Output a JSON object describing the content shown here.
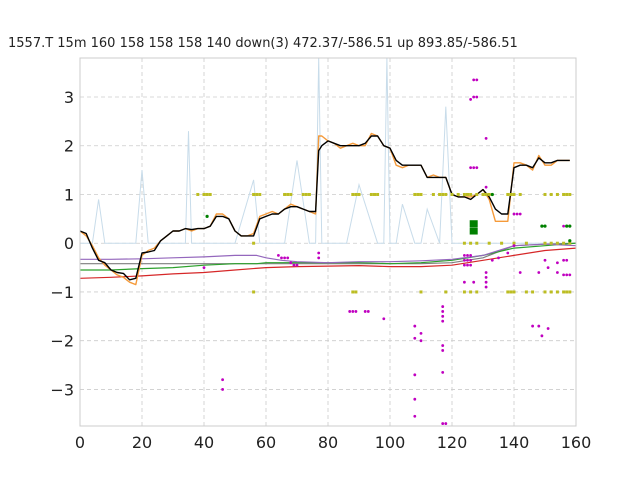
{
  "chart_data": {
    "type": "line",
    "title": "1557.T 15m 160 158 158 158 140  down(3) 472.37/-586.51 up 893.85/-586.51",
    "xlabel": "",
    "ylabel": "",
    "xlim": [
      0,
      160
    ],
    "ylim": [
      -3.75,
      3.8
    ],
    "xticks": [
      0,
      20,
      40,
      60,
      80,
      100,
      120,
      140,
      160
    ],
    "yticks": [
      -3,
      -2,
      -1,
      0,
      1,
      2,
      3
    ],
    "xtick_labels": [
      "0",
      "20",
      "40",
      "60",
      "80",
      "100",
      "120",
      "140",
      "160"
    ],
    "ytick_labels": [
      "−3",
      "−2",
      "−1",
      "0",
      "1",
      "2",
      "3"
    ],
    "grid": true,
    "colors": {
      "price": "#000000",
      "orange": "#f59a3a",
      "purple": "#9467bd",
      "green": "#2ca02c",
      "red": "#d62728",
      "gray": "#7f7f7f",
      "background_spikes": "#c8dcea",
      "olive_marks": "#bcbd22",
      "magenta_marks": "#c000c0",
      "green_marks": "#008000"
    },
    "series": [
      {
        "key": "price",
        "x": [
          0,
          2,
          4,
          6,
          8,
          10,
          12,
          14,
          16,
          18,
          20,
          22,
          24,
          26,
          28,
          30,
          32,
          34,
          36,
          38,
          40,
          42,
          44,
          46,
          48,
          50,
          52,
          54,
          56,
          58,
          60,
          62,
          64,
          66,
          68,
          70,
          72,
          74,
          76,
          77,
          78,
          80,
          82,
          84,
          86,
          88,
          90,
          92,
          94,
          96,
          98,
          100,
          102,
          104,
          106,
          108,
          110,
          112,
          114,
          116,
          118,
          120,
          122,
          124,
          126,
          128,
          130,
          132,
          134,
          136,
          138,
          140,
          142,
          144,
          146,
          148,
          150,
          152,
          154,
          156,
          158
        ],
        "y": [
          0.25,
          0.2,
          -0.1,
          -0.35,
          -0.4,
          -0.55,
          -0.6,
          -0.62,
          -0.75,
          -0.72,
          -0.2,
          -0.18,
          -0.15,
          0.05,
          0.15,
          0.25,
          0.25,
          0.3,
          0.28,
          0.3,
          0.3,
          0.35,
          0.55,
          0.55,
          0.5,
          0.25,
          0.15,
          0.15,
          0.15,
          0.5,
          0.55,
          0.6,
          0.6,
          0.7,
          0.75,
          0.75,
          0.7,
          0.65,
          0.65,
          1.9,
          2.0,
          2.1,
          2.05,
          2.0,
          2.0,
          2.0,
          2.0,
          2.05,
          2.2,
          2.2,
          2.0,
          1.95,
          1.7,
          1.6,
          1.6,
          1.6,
          1.6,
          1.35,
          1.35,
          1.35,
          1.35,
          1.0,
          0.95,
          0.95,
          0.9,
          1.0,
          1.1,
          0.95,
          0.7,
          0.6,
          0.6,
          1.55,
          1.6,
          1.6,
          1.55,
          1.75,
          1.65,
          1.65,
          1.7,
          1.7,
          1.7
        ]
      },
      {
        "key": "orange",
        "x": [
          0,
          2,
          4,
          6,
          8,
          10,
          12,
          14,
          16,
          18,
          20,
          22,
          24,
          26,
          28,
          30,
          32,
          34,
          36,
          38,
          40,
          42,
          44,
          46,
          48,
          50,
          52,
          54,
          56,
          58,
          60,
          62,
          64,
          66,
          68,
          70,
          72,
          74,
          76,
          77,
          78,
          80,
          82,
          84,
          86,
          88,
          90,
          92,
          94,
          96,
          98,
          100,
          102,
          104,
          106,
          108,
          110,
          112,
          114,
          116,
          118,
          120,
          122,
          124,
          126,
          128,
          130,
          132,
          134,
          136,
          138,
          140,
          142,
          144,
          146,
          148,
          150,
          152,
          154,
          156,
          158
        ],
        "y": [
          0.25,
          0.15,
          -0.05,
          -0.3,
          -0.45,
          -0.55,
          -0.65,
          -0.7,
          -0.8,
          -0.85,
          -0.25,
          -0.15,
          -0.1,
          0.05,
          0.15,
          0.25,
          0.25,
          0.3,
          0.25,
          0.3,
          0.3,
          0.35,
          0.6,
          0.6,
          0.5,
          0.25,
          0.15,
          0.15,
          0.2,
          0.55,
          0.6,
          0.65,
          0.6,
          0.7,
          0.8,
          0.75,
          0.7,
          0.65,
          0.6,
          2.2,
          2.2,
          2.1,
          2.05,
          1.95,
          2.0,
          2.05,
          2.0,
          2.0,
          2.25,
          2.2,
          2.0,
          1.95,
          1.6,
          1.55,
          1.6,
          1.6,
          1.6,
          1.35,
          1.4,
          1.35,
          1.35,
          1.0,
          0.95,
          0.95,
          0.95,
          1.0,
          1.1,
          0.9,
          0.45,
          0.45,
          0.45,
          1.65,
          1.65,
          1.6,
          1.5,
          1.8,
          1.6,
          1.6,
          1.7,
          1.7,
          1.7
        ]
      },
      {
        "key": "purple",
        "x": [
          0,
          10,
          20,
          30,
          40,
          50,
          57,
          60,
          65,
          70,
          80,
          90,
          100,
          110,
          120,
          130,
          140,
          150,
          160
        ],
        "y": [
          -0.33,
          -0.33,
          -0.32,
          -0.3,
          -0.28,
          -0.25,
          -0.25,
          -0.3,
          -0.35,
          -0.38,
          -0.4,
          -0.38,
          -0.38,
          -0.36,
          -0.33,
          -0.25,
          -0.05,
          -0.02,
          -0.05
        ]
      },
      {
        "key": "green",
        "x": [
          0,
          10,
          20,
          30,
          40,
          50,
          57,
          60,
          65,
          70,
          80,
          90,
          100,
          110,
          120,
          130,
          140,
          150,
          160
        ],
        "y": [
          -0.55,
          -0.55,
          -0.52,
          -0.5,
          -0.45,
          -0.42,
          -0.42,
          -0.4,
          -0.4,
          -0.4,
          -0.4,
          -0.4,
          -0.42,
          -0.4,
          -0.35,
          -0.25,
          -0.1,
          -0.05,
          0.0
        ]
      },
      {
        "key": "red",
        "x": [
          0,
          10,
          20,
          30,
          40,
          50,
          60,
          70,
          80,
          90,
          100,
          110,
          120,
          130,
          140,
          150,
          160
        ],
        "y": [
          -0.72,
          -0.7,
          -0.67,
          -0.63,
          -0.6,
          -0.55,
          -0.5,
          -0.48,
          -0.47,
          -0.46,
          -0.48,
          -0.48,
          -0.45,
          -0.35,
          -0.25,
          -0.15,
          -0.1
        ]
      },
      {
        "key": "gray",
        "x": [
          0,
          60,
          70,
          80,
          90,
          100,
          110,
          120,
          130,
          140,
          150,
          160
        ],
        "y": [
          -0.42,
          -0.42,
          -0.42,
          -0.42,
          -0.42,
          -0.42,
          -0.42,
          -0.4,
          -0.3,
          -0.05,
          -0.02,
          0.0
        ]
      },
      {
        "key": "background_spikes",
        "x": [
          0,
          4,
          6,
          8,
          16,
          18,
          20,
          22,
          30,
          34,
          35,
          36,
          40,
          50,
          56,
          58,
          60,
          66,
          70,
          74,
          76,
          77,
          78,
          80,
          86,
          90,
          96,
          98,
          99,
          100,
          102,
          104,
          108,
          110,
          112,
          116,
          118,
          120,
          126,
          128,
          130,
          136,
          138,
          140,
          146,
          150,
          156,
          160
        ],
        "y": [
          0,
          0,
          0.9,
          0,
          0,
          0,
          1.5,
          0,
          0,
          0,
          2.3,
          0,
          0,
          0,
          1.3,
          0,
          0,
          0,
          1.7,
          0,
          0,
          3.8,
          0,
          0,
          0,
          1.2,
          0,
          0,
          3.8,
          0,
          0,
          0.8,
          0,
          0,
          0.7,
          0,
          2.8,
          0,
          0,
          0,
          0,
          0,
          0,
          0,
          0,
          0,
          0,
          0
        ]
      }
    ],
    "annotations": {
      "olive_rows": [
        {
          "y": 1.0,
          "x": [
            38,
            40,
            41,
            42,
            56,
            57,
            58,
            66,
            67,
            68,
            72,
            73,
            74,
            88,
            89,
            90,
            94,
            95,
            96,
            108,
            109,
            110,
            114,
            116,
            117,
            118,
            120,
            122,
            124,
            125,
            126,
            128,
            130,
            131,
            132,
            138,
            139,
            140,
            142,
            150,
            152,
            154,
            156,
            157,
            158
          ]
        },
        {
          "y": 0.0,
          "x": [
            56,
            124,
            126,
            128,
            132,
            136,
            140,
            144,
            150,
            152,
            154,
            156,
            158
          ]
        },
        {
          "y": -1.0,
          "x": [
            56,
            88,
            89,
            110,
            118,
            124,
            126,
            128,
            138,
            139,
            140,
            144,
            146,
            150,
            152,
            154,
            156,
            157,
            158
          ]
        }
      ],
      "magenta_points": [
        [
          40,
          -0.5
        ],
        [
          46,
          -2.8
        ],
        [
          46,
          -3.0
        ],
        [
          64,
          -0.25
        ],
        [
          65,
          -0.3
        ],
        [
          66,
          -0.3
        ],
        [
          67,
          -0.3
        ],
        [
          68,
          -0.4
        ],
        [
          69,
          -0.45
        ],
        [
          70,
          -0.45
        ],
        [
          77,
          -0.3
        ],
        [
          77,
          -0.2
        ],
        [
          87,
          -1.4
        ],
        [
          88,
          -1.4
        ],
        [
          89,
          -1.4
        ],
        [
          92,
          -1.4
        ],
        [
          93,
          -1.4
        ],
        [
          98,
          -1.55
        ],
        [
          108,
          -1.7
        ],
        [
          108,
          -1.95
        ],
        [
          108,
          -2.7
        ],
        [
          108,
          -3.2
        ],
        [
          108,
          -3.55
        ],
        [
          110,
          -1.85
        ],
        [
          110,
          -2.0
        ],
        [
          117,
          -1.3
        ],
        [
          117,
          -1.4
        ],
        [
          117,
          -1.5
        ],
        [
          117,
          -1.6
        ],
        [
          117,
          -2.1
        ],
        [
          117,
          -2.2
        ],
        [
          117,
          -2.65
        ],
        [
          117,
          -3.7
        ],
        [
          118,
          -3.7
        ],
        [
          124,
          -0.25
        ],
        [
          124,
          -0.35
        ],
        [
          124,
          -0.45
        ],
        [
          124,
          -0.8
        ],
        [
          125,
          -0.25
        ],
        [
          125,
          -0.35
        ],
        [
          125,
          -0.45
        ],
        [
          126,
          -0.25
        ],
        [
          126,
          -0.35
        ],
        [
          126,
          -0.45
        ],
        [
          127,
          -0.8
        ],
        [
          126,
          1.55
        ],
        [
          127,
          1.55
        ],
        [
          128,
          1.55
        ],
        [
          126,
          2.95
        ],
        [
          127,
          3.0
        ],
        [
          128,
          3.0
        ],
        [
          127,
          3.35
        ],
        [
          128,
          3.35
        ],
        [
          131,
          -0.6
        ],
        [
          131,
          -0.7
        ],
        [
          131,
          -0.8
        ],
        [
          131,
          -0.9
        ],
        [
          131,
          1.15
        ],
        [
          131,
          2.15
        ],
        [
          133,
          -0.35
        ],
        [
          135,
          -0.3
        ],
        [
          138,
          -0.2
        ],
        [
          140,
          -0.05
        ],
        [
          142,
          -0.6
        ],
        [
          146,
          -1.7
        ],
        [
          148,
          -1.7
        ],
        [
          148,
          -0.6
        ],
        [
          149,
          -1.9
        ],
        [
          150,
          -0.35
        ],
        [
          151,
          -0.5
        ],
        [
          151,
          -1.75
        ],
        [
          154,
          -0.4
        ],
        [
          154,
          -0.6
        ],
        [
          156,
          -0.35
        ],
        [
          157,
          -0.35
        ],
        [
          156,
          -0.65
        ],
        [
          157,
          -0.65
        ],
        [
          158,
          -0.65
        ],
        [
          156,
          0.35
        ],
        [
          157,
          0.35
        ],
        [
          158,
          0.35
        ],
        [
          140,
          0.6
        ],
        [
          141,
          0.6
        ],
        [
          142,
          0.6
        ]
      ],
      "green_points": [
        [
          41,
          0.55
        ],
        [
          149,
          0.35
        ],
        [
          150,
          0.35
        ],
        [
          157,
          0.35
        ],
        [
          158,
          0.35
        ],
        [
          158,
          0.05
        ],
        [
          133,
          1.0
        ]
      ],
      "green_squares": [
        [
          127,
          0.4
        ],
        [
          127,
          0.25
        ]
      ]
    }
  }
}
